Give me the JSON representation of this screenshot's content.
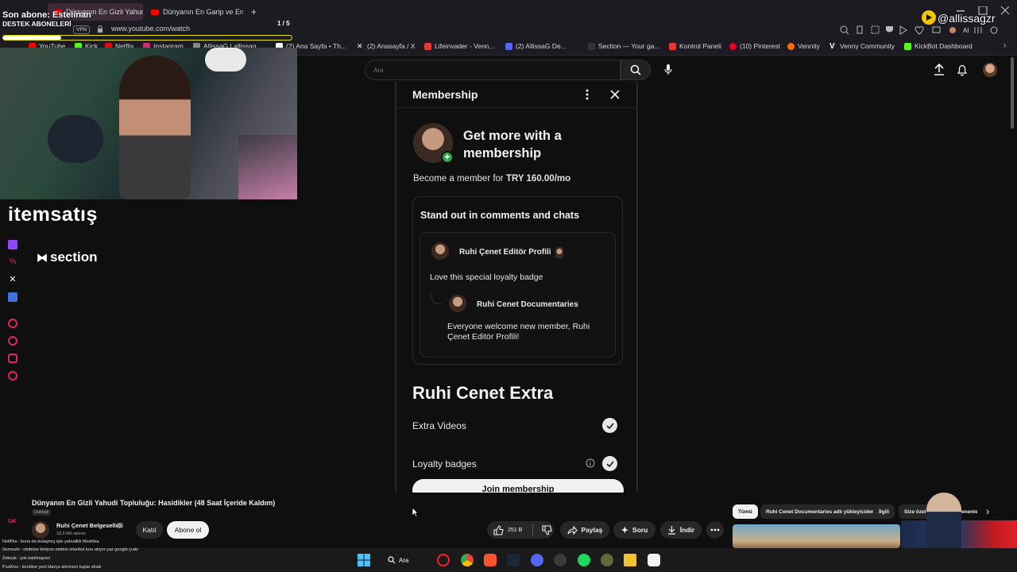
{
  "browser": {
    "tabs": [
      {
        "title": "Dünyanın En Gizli Yahudi To",
        "active": true
      },
      {
        "title": "Dünyanın En Garip ve En G",
        "active": false
      }
    ],
    "new_tab": "+",
    "url": "www.youtube.com/watch",
    "vpn_label": "VPN",
    "bookmarks": [
      {
        "label": "YouTube",
        "color": "#ff0000"
      },
      {
        "label": "Kick",
        "color": "#53fc18"
      },
      {
        "label": "Netflix",
        "color": "#e50914"
      },
      {
        "label": "Instagram",
        "color": "#d62976"
      },
      {
        "label": "AllissaG | allissag...",
        "color": "#888888"
      },
      {
        "label": "(2) Ana Sayfa • Th...",
        "color": "#ffffff"
      },
      {
        "label": "(2) Anasayfa / X",
        "color": "#ffffff"
      },
      {
        "label": "Lifeinvader - Venn...",
        "color": "#e53935"
      },
      {
        "label": "(2) AllissaG De...",
        "color": "#5865f2"
      },
      {
        "label": "Section — Your ga...",
        "color": "#222222"
      },
      {
        "label": "Kontrol Paneli",
        "color": "#e53935"
      },
      {
        "label": "(10) Pinterest",
        "color": "#e60023"
      },
      {
        "label": "Vennity",
        "color": "#ff6f00"
      },
      {
        "label": "Venny Community",
        "color": "#ffffff"
      },
      {
        "label": "KickBot Dashboard",
        "color": "#53fc18"
      }
    ]
  },
  "youtube": {
    "search_placeholder": "Ara",
    "panel": {
      "title": "Membership",
      "hero_title": "Get more with a membership",
      "price_prefix": "Become a member for ",
      "price": "TRY 160.00/mo",
      "section1_title": "Stand out in comments and chats",
      "comment1_user": "Ruhi Çenet Editör Profili",
      "comment1_text": "Love this special loyalty badge",
      "comment2_user": "Ruhi Cenet Documentaries",
      "comment2_text": "Everyone welcome new member, Ruhi Çenet Editör Profili!",
      "tier_title": "Ruhi Cenet Extra",
      "perks": [
        {
          "label": "Extra Videos",
          "included": true
        },
        {
          "label": "Loyalty badges",
          "included": true
        }
      ],
      "join_button": "Join membership"
    },
    "video": {
      "title": "Dünyanın En Gizli Yahudi Topluluğu: Hasidikler (48 Saat İçeride Kaldım)",
      "dubbed": "Dublajlı",
      "channel": "Ruhi Çenet Belgeselleri",
      "subs": "18,5 Mn abone",
      "join_label": "Katıl",
      "subscribe_label": "Abone ol",
      "likes": "251 B",
      "share_label": "Paylaş",
      "ask_label": "Soru",
      "download_label": "İndir"
    },
    "chips": [
      "Tümü",
      "Ruhi Cenet Documentaries adlı yükleyiciden",
      "İlgili",
      "Size özel",
      "yüklenenler"
    ]
  },
  "stream_overlay": {
    "last_sub_label": "Son abone: Estelinan",
    "goal_label": "DESTEK ABONELERİ",
    "goal_count": "1 / 5",
    "goal_progress": 0.2,
    "streamer_handle": "@allissagzr",
    "sponsor1": "itemsatış",
    "sponsor2": "section",
    "chat": [
      "Netfl!ks : buna da bulaşmış işte yahudilik fdsafdsa",
      "Servoulo : otobüse biniyon otobüs istanbul turu atıyor yaz google çıakr",
      "Zekeyk : yok katılmayoız",
      "PusKivo : kendine yeni klavye alırmısın tuşlar eksik"
    ],
    "gk_label": "GK"
  },
  "taskbar": {
    "search_label": "Ara"
  }
}
